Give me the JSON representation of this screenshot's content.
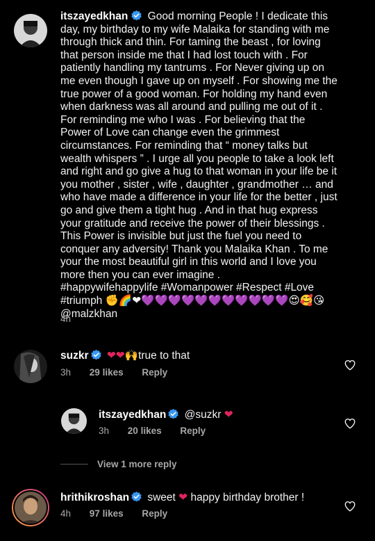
{
  "post": {
    "username": "itszayedkhan",
    "caption": "Good morning People ! I dedicate this day, my birthday to my wife Malaika for standing with me through thick and thin. For taming the beast , for loving that person inside me that I had lost touch with . For patiently handling my tantrums . For Never giving up on me even though I gave up on myself . For showing me the true power of a good woman. For holding my hand even when darkness was all around and pulling me out of it . For reminding me who I was . For believing that the Power of Love can change even the grimmest circumstances. For reminding that “ money talks but wealth whispers ” . I urge all you people to take a look left and right and go give a hug to that woman in your life be it you mother , sister , wife , daughter , grandmother … and who have made a difference in your life for the better , just go and give them a tight hug . And in that hug express your gratitude and receive the power of their blessings . This Power is invisible but just the fuel you need to conquer any adversity! Thank you Malaika Khan . To me your the most beautiful girl in this world and I love you more then you can ever imagine .",
    "hashtags_line1": "#happywifehappylife #Womanpower #Respect #Love",
    "hashtags_line2": "#triumph",
    "emojis": "✊🌈❤💜💜💜💜💜💜💜💜💜💜💜😍🥰😘",
    "mention": "@malzkhan",
    "time": "4h"
  },
  "comments": [
    {
      "username": "suzkr",
      "text": "true to that",
      "emoji_prefix": "❤❤🙌",
      "time": "3h",
      "likes": "29 likes",
      "reply": "Reply"
    },
    {
      "username": "itszayedkhan",
      "mention": "@suzkr",
      "emoji_suffix": "❤",
      "time": "3h",
      "likes": "20 likes",
      "reply": "Reply"
    },
    {
      "username": "hrithikroshan",
      "text_before": "sweet",
      "emoji_mid": "❤",
      "text_after": "happy birthday brother !",
      "time": "4h",
      "likes": "97 likes",
      "reply": "Reply"
    }
  ],
  "view_more": "View 1 more reply",
  "colors": {
    "background": "#000000",
    "verified": "#3897f0",
    "muted": "#a8a8a8",
    "heart": "#e0245e",
    "story_ring_start": "#f9a03f",
    "story_ring_end": "#c13584"
  }
}
